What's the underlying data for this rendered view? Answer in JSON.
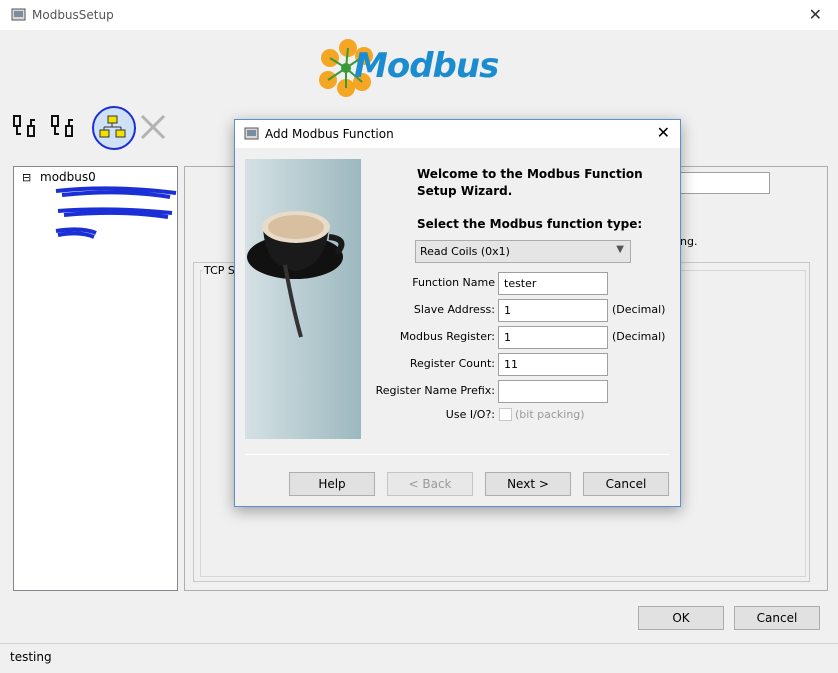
{
  "window": {
    "title": "ModbusSetup"
  },
  "logo": {
    "text": "Modbus"
  },
  "toolbar": {
    "icons": [
      "connect-serial-icon",
      "connect-serial-alt-icon",
      "network-icon",
      "delete-network-icon"
    ]
  },
  "tree": {
    "root": "modbus0",
    "expander": "⊟"
  },
  "right_panel": {
    "text_fragment": "ng.",
    "group_label": "TCP S"
  },
  "main_buttons": {
    "ok": "OK",
    "cancel": "Cancel"
  },
  "status": {
    "text": "testing"
  },
  "dialog": {
    "title": "Add Modbus Function",
    "welcome": "Welcome to the Modbus Function Setup Wizard.",
    "select_label": "Select the Modbus function type:",
    "function_type": "Read Coils (0x1)",
    "fields": {
      "function_name_label": "Function Name",
      "function_name_value": "tester",
      "slave_address_label": "Slave Address:",
      "slave_address_value": "1",
      "slave_address_unit": "(Decimal)",
      "modbus_register_label": "Modbus Register:",
      "modbus_register_value": "1",
      "modbus_register_unit": "(Decimal)",
      "register_count_label": "Register Count:",
      "register_count_value": "11",
      "register_prefix_label": "Register Name Prefix:",
      "register_prefix_value": "",
      "use_io_label": "Use I/O?:",
      "use_io_hint": "(bit packing)"
    },
    "buttons": {
      "help": "Help",
      "back": "< Back",
      "next": "Next >",
      "cancel": "Cancel"
    }
  },
  "colors": {
    "accent": "#1a8ccf",
    "logo_orange": "#f5a623",
    "dialog_border": "#5a8fd0"
  }
}
